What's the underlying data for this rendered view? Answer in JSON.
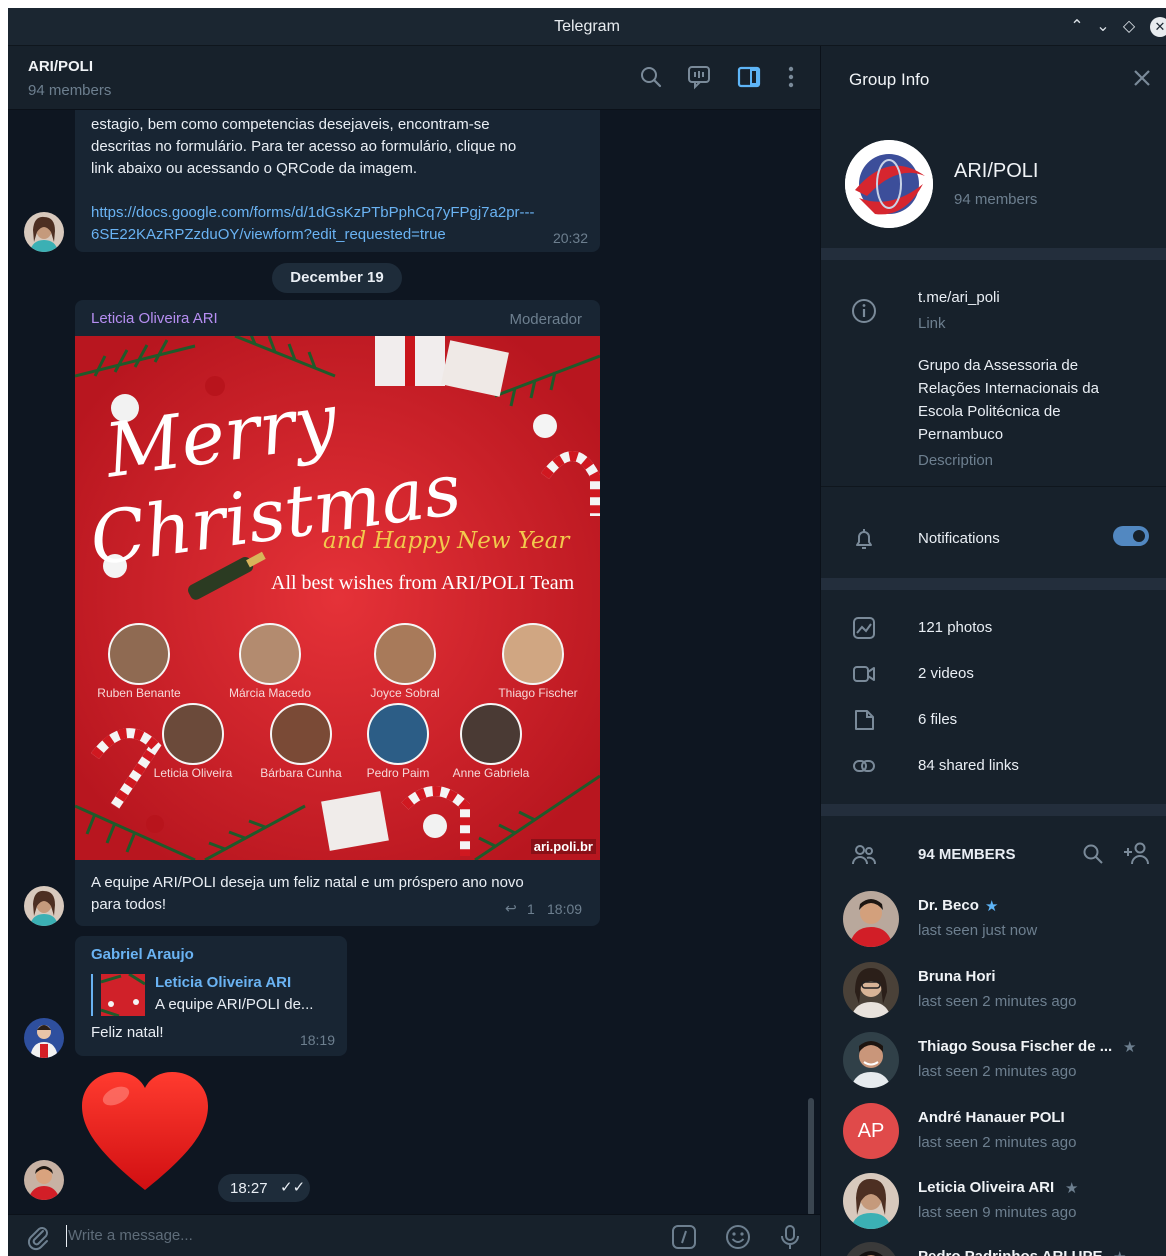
{
  "window": {
    "title": "Telegram",
    "controls": [
      "⌃",
      "⌄",
      "◇",
      "✕"
    ]
  },
  "chat_header": {
    "name": "ARI/POLI",
    "members": "94 members"
  },
  "messages": {
    "m1": {
      "text": "estagio, bem como competencias desejaveis, encontram-se descritas no formulário. Para ter acesso ao formulário, clique no link abaixo ou acessando o QRCode da imagem.",
      "line1": "estagio, bem como competencias desejaveis, encontram-se",
      "line2": "descritas no formulário. Para ter acesso ao formulário, clique no",
      "line3": "link abaixo ou acessando o QRCode da imagem.",
      "link1": "https://docs.google.com/forms/d/1dGsKzPTbPphCq7yFPgj7a2pr---",
      "link2": "6SE22KAzRPZzduOY/viewform?edit_requested=true",
      "time": "20:32"
    },
    "date_separator": "December 19",
    "m2": {
      "sender": "Leticia Oliveira ARI",
      "role": "Moderador",
      "image": {
        "script_line1": "Merry",
        "script_line2": "Christmas",
        "script_line3": "and Happy New Year",
        "wishes": "All best wishes from ARI/POLI Team",
        "people_row1": [
          "Ruben Benante",
          "Márcia Macedo",
          "Joyce Sobral",
          "Thiago Fischer"
        ],
        "people_row2": [
          "Leticia Oliveira",
          "Bárbara Cunha",
          "Pedro Paim",
          "Anne Gabriela"
        ],
        "site": "ari.poli.br"
      },
      "caption_line1": "A equipe ARI/POLI deseja um feliz natal e um próspero ano novo",
      "caption_line2": "para todos!",
      "replies": "1",
      "time": "18:09"
    },
    "m3": {
      "sender": "Gabriel Araujo",
      "reply_to_name": "Leticia Oliveira ARI",
      "reply_to_text": "A equipe ARI/POLI de...",
      "text": "Feliz natal!",
      "time": "18:19"
    },
    "m4": {
      "sticker": "heart",
      "time": "18:27"
    }
  },
  "composer": {
    "placeholder": "Write a message..."
  },
  "group_info": {
    "title": "Group Info",
    "name": "ARI/POLI",
    "members": "94 members",
    "link": "t.me/ari_poli",
    "link_label": "Link",
    "desc_line1": "Grupo da Assessoria de",
    "desc_line2": "Relações Internacionais da",
    "desc_line3": "Escola Politécnica de",
    "desc_line4": "Pernambuco",
    "description_label": "Description",
    "notifications_label": "Notifications",
    "notifications_on": true,
    "media": {
      "photos": "121 photos",
      "videos": "2 videos",
      "files": "6 files",
      "links": "84 shared links"
    },
    "members_header": "94 MEMBERS",
    "member_list": [
      {
        "name": "Dr. Beco",
        "status": "last seen just now",
        "star": "★"
      },
      {
        "name": "Bruna Hori",
        "status": "last seen 2 minutes ago",
        "star": ""
      },
      {
        "name": "Thiago Sousa Fischer de ...",
        "status": "last seen 2 minutes ago",
        "star": "★"
      },
      {
        "name": "André Hanauer POLI",
        "status": "last seen 2 minutes ago",
        "star": "",
        "initials": "AP"
      },
      {
        "name": "Leticia Oliveira ARI",
        "status": "last seen 9 minutes ago",
        "star": "★"
      },
      {
        "name": "Pedro Padrinhos ARI UPE",
        "status": "",
        "star": "★"
      }
    ]
  },
  "colors": {
    "accent": "#5288c1",
    "link": "#6ab3f3",
    "sender_purple": "#b68ef2",
    "sender_blue": "#6ab3f3",
    "bg_chat": "#0e1621",
    "bubble": "#182533",
    "panel": "#17212b",
    "xmas_red": "#d9262e"
  }
}
